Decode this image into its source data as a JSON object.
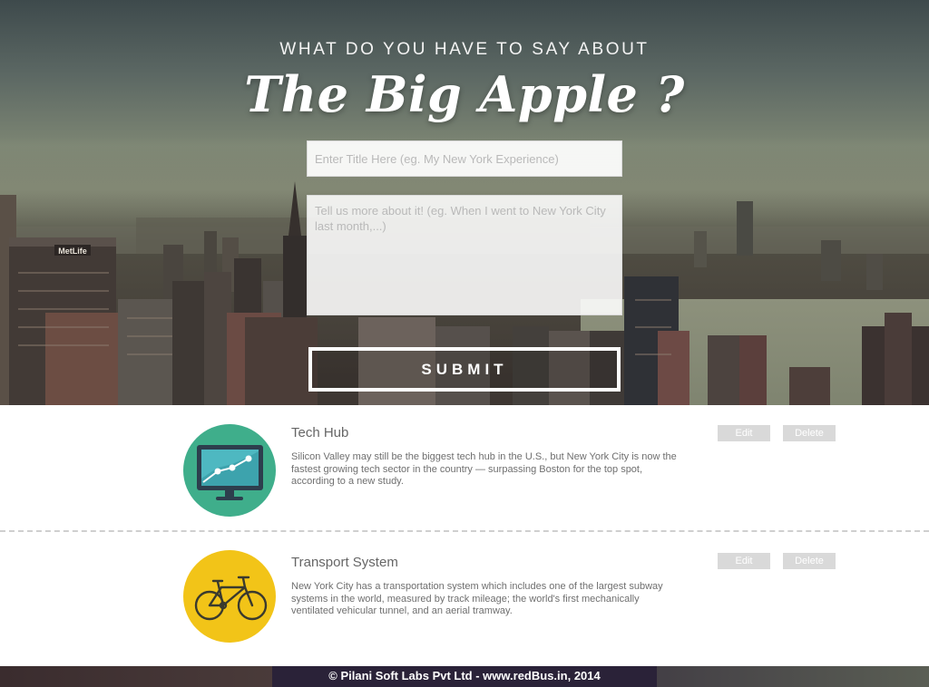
{
  "hero": {
    "kicker": "WHAT DO YOU HAVE TO SAY ABOUT",
    "title": "The Big Apple ?",
    "building_sign": "MetLife"
  },
  "form": {
    "title_placeholder": "Enter Title Here (eg. My New York Experience)",
    "title_value": "",
    "story_placeholder": "Tell us more about it! (eg. When I went to New York City last month,...)",
    "story_value": "",
    "submit_label": "SUBMIT"
  },
  "posts": [
    {
      "title": "Tech Hub",
      "description": "Silicon Valley may still be the biggest tech hub in the U.S., but New York City is now the fastest growing tech sector in the country — surpassing Boston for the top spot, according to a new study.",
      "icon": "monitor-chart-icon",
      "icon_bg": "#3fae8b",
      "edit_label": "Edit",
      "delete_label": "Delete"
    },
    {
      "title": "Transport System",
      "description": "New York City has a transportation system which includes one of the largest subway systems in the world, measured by track mileage; the world's first mechanically ventilated vehicular tunnel, and an aerial tramway.",
      "icon": "bicycle-icon",
      "icon_bg": "#f2c418",
      "edit_label": "Edit",
      "delete_label": "Delete"
    }
  ],
  "footer": {
    "copyright": "© Pilani Soft Labs Pvt Ltd - www.redBus.in, 2014"
  }
}
